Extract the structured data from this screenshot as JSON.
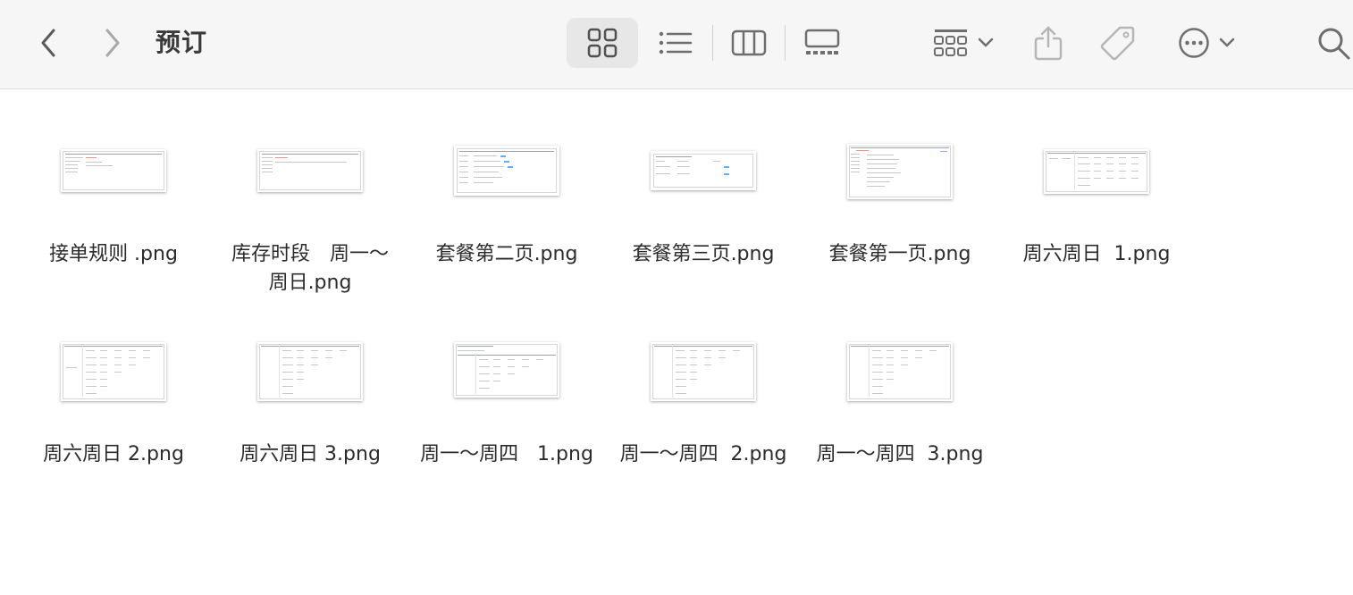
{
  "toolbar": {
    "title": "预订",
    "icons": {
      "back": "chevron-left-icon",
      "forward": "chevron-right-icon",
      "view_icons": "grid-view-icon",
      "view_list": "list-view-icon",
      "view_columns": "column-view-icon",
      "view_gallery": "gallery-view-icon",
      "group": "group-by-icon",
      "share": "share-icon",
      "tags": "tag-icon",
      "more": "ellipsis-circle-icon",
      "search": "search-icon"
    },
    "active_view": "icons"
  },
  "files": [
    {
      "name": "接单规则 .png"
    },
    {
      "name": "库存时段　周一～\n周日.png"
    },
    {
      "name": "套餐第二页.png"
    },
    {
      "name": "套餐第三页.png"
    },
    {
      "name": "套餐第一页.png"
    },
    {
      "name": "周六周日  1.png"
    },
    {
      "name": "周六周日 2.png"
    },
    {
      "name": "周六周日 3.png"
    },
    {
      "name": "周一～周四   1.png"
    },
    {
      "name": "周一～周四  2.png"
    },
    {
      "name": "周一～周四  3.png"
    }
  ],
  "colors": {
    "toolbar_bg": "#f6f6f6",
    "icon": "#6e6e6e",
    "active_view_bg": "#e7e7e7",
    "text": "#2b2b2b"
  }
}
